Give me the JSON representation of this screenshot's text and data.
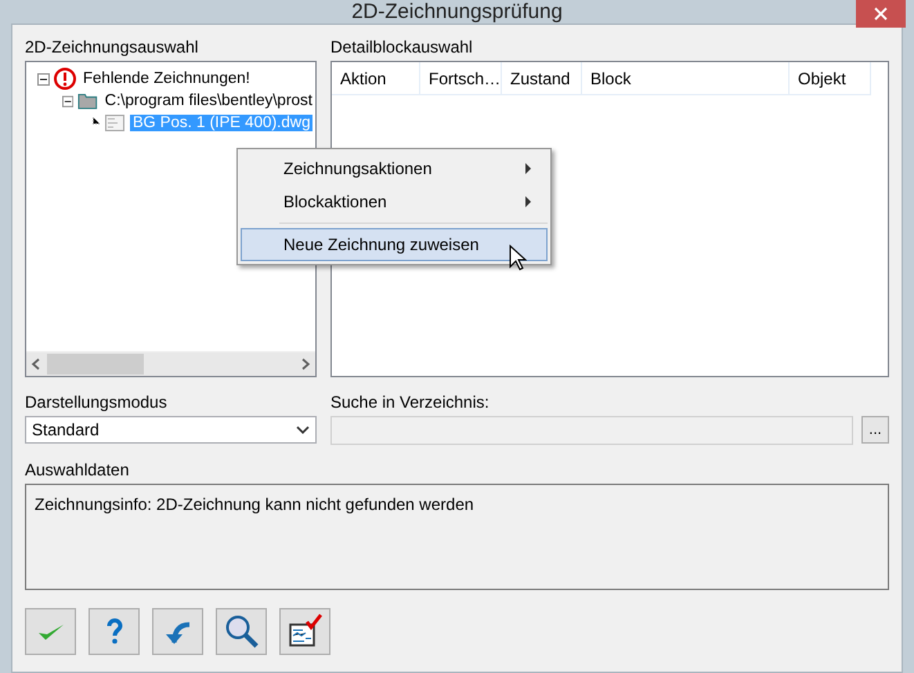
{
  "window": {
    "title": "2D-Zeichnungsprüfung"
  },
  "selection_panel": {
    "label": "2D-Zeichnungsauswahl",
    "tree": [
      {
        "label": "Fehlende Zeichnungen!",
        "kind": "warning",
        "expanded": true,
        "selected": false,
        "children": [
          {
            "label": "C:\\program files\\bentley\\prost",
            "kind": "folder",
            "expanded": true,
            "selected": false,
            "children": [
              {
                "label": "BG Pos. 1 (IPE 400).dwg",
                "kind": "file",
                "selected": true
              }
            ]
          }
        ]
      }
    ]
  },
  "detail_panel": {
    "label": "Detailblockauswahl",
    "columns": [
      "Aktion",
      "Fortsch…",
      "Zustand",
      "Block",
      "Objekt"
    ]
  },
  "context_menu": [
    {
      "label": "Zeichnungsaktionen",
      "kind": "submenu",
      "selected": false
    },
    {
      "label": "Blockaktionen",
      "kind": "submenu",
      "selected": false
    },
    {
      "kind": "separator"
    },
    {
      "label": "Neue Zeichnung zuweisen",
      "kind": "item",
      "selected": true
    }
  ],
  "display_mode": {
    "label": "Darstellungsmodus",
    "value": "Standard"
  },
  "search_directory": {
    "label": "Suche in Verzeichnis:",
    "disabled": true,
    "browse": "..."
  },
  "selection_data": {
    "label": "Auswahldaten",
    "text": "Zeichnungsinfo: 2D-Zeichnung kann nicht gefunden werden"
  },
  "toolbar": [
    {
      "kind": "ok"
    },
    {
      "kind": "help"
    },
    {
      "kind": "undo"
    },
    {
      "kind": "search"
    },
    {
      "kind": "report"
    }
  ]
}
